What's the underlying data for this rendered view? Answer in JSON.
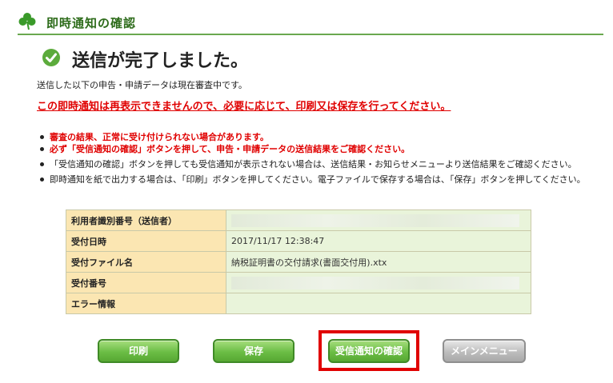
{
  "header": {
    "title": "即時通知の確認"
  },
  "main": {
    "done_title": "送信が完了しました。",
    "info_text": "送信した以下の申告・申請データは現在審査中です。",
    "warning_text": "この即時通知は再表示できませんので、必要に応じて、印刷又は保存を行ってください。",
    "bullets": [
      "審査の結果、正常に受け付けられない場合があります。",
      "必ず「受信通知の確認」ボタンを押して、申告・申請データの送信結果をご確認ください。",
      "「受信通知の確認」ボタンを押しても受信通知が表示されない場合は、送信結果・お知らせメニューより送信結果をご確認ください。",
      "即時通知を紙で出力する場合は、「印刷」ボタンを押してください。電子ファイルで保存する場合は、「保存」ボタンを押してください。"
    ]
  },
  "table": {
    "rows": [
      {
        "label": "利用者識別番号（送信者）",
        "value": ""
      },
      {
        "label": "受付日時",
        "value": "2017/11/17 12:38:47"
      },
      {
        "label": "受付ファイル名",
        "value": "納税証明書の交付請求(書面交付用).xtx"
      },
      {
        "label": "受付番号",
        "value": ""
      },
      {
        "label": "エラー情報",
        "value": ""
      }
    ]
  },
  "buttons": {
    "print": "印刷",
    "save": "保存",
    "confirm": "受信通知の確認",
    "main_menu": "メインメニュー"
  },
  "colors": {
    "accent": "#6bbd45",
    "warning": "#e00000",
    "label_bg": "#fbe6b2",
    "value_bg": "#e9f4da"
  },
  "icons": {
    "header": "clover-icon",
    "done": "check-circle-icon"
  }
}
